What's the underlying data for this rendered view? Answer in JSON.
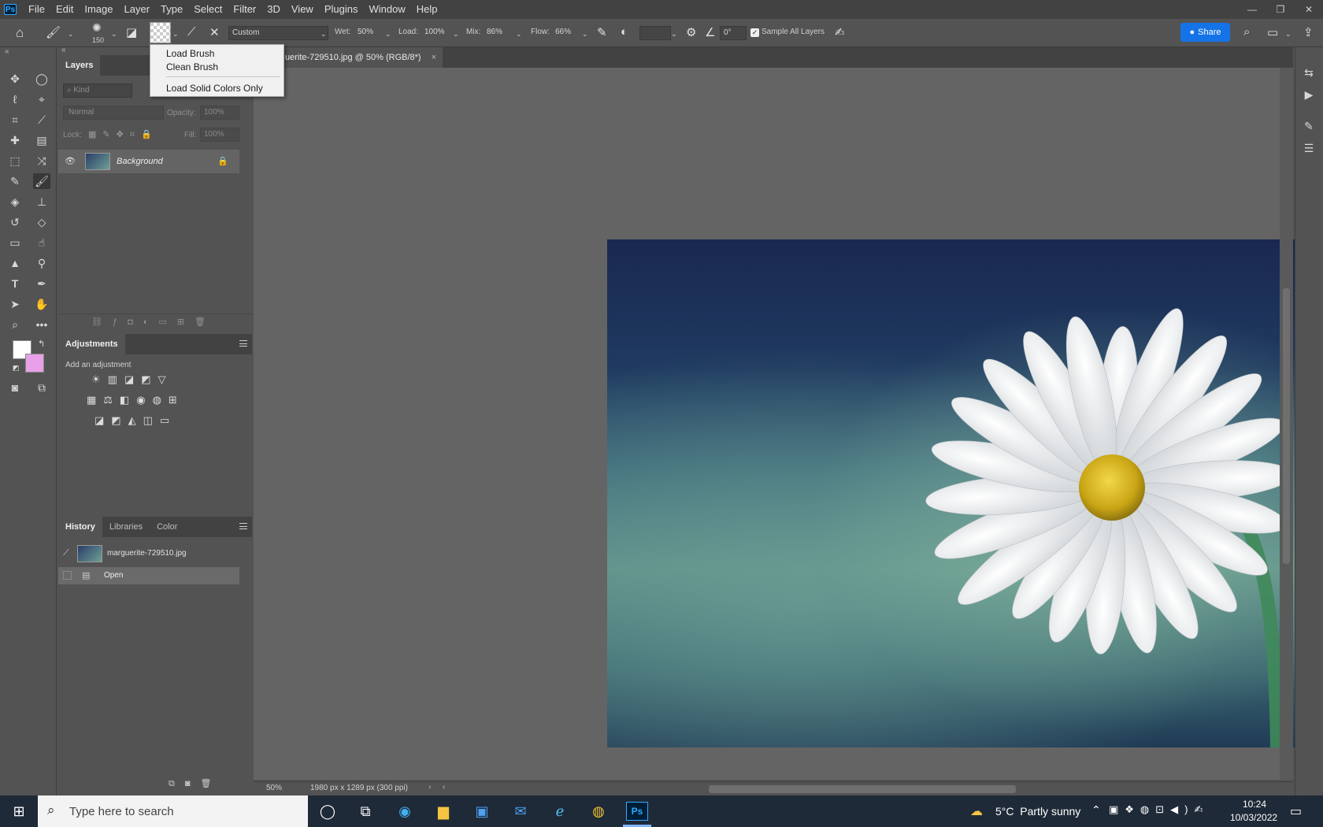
{
  "app": {
    "logo": "Ps"
  },
  "menu": [
    "File",
    "Edit",
    "Image",
    "Layer",
    "Type",
    "Select",
    "Filter",
    "3D",
    "View",
    "Plugins",
    "Window",
    "Help"
  ],
  "options": {
    "brush_size": "150",
    "preset": "Custom",
    "wet_label": "Wet:",
    "wet": "50%",
    "load_label": "Load:",
    "load": "100%",
    "mix_label": "Mix:",
    "mix": "86%",
    "flow_label": "Flow:",
    "flow": "66%",
    "angle": "0°",
    "sample_all_layers": "Sample All Layers",
    "share": "Share"
  },
  "dropdown": {
    "items": [
      "Load Brush",
      "Clean Brush",
      "Load Solid Colors Only"
    ]
  },
  "layers_panel": {
    "tab": "Layers",
    "kind_placeholder": "Kind",
    "blend_mode": "Normal",
    "opacity_label": "Opacity:",
    "opacity": "100%",
    "lock_label": "Lock:",
    "fill_label": "Fill:",
    "fill": "100%",
    "layer_name": "Background"
  },
  "adjustments_panel": {
    "tab": "Adjustments",
    "hint": "Add an adjustment"
  },
  "history_panel": {
    "tabs": [
      "History",
      "Libraries",
      "Color"
    ],
    "snapshot": "marguerite-729510.jpg",
    "step": "Open"
  },
  "document": {
    "tab_title": "uerite-729510.jpg @ 50% (RGB/8*)",
    "close": "×"
  },
  "status": {
    "zoom": "50%",
    "doc_info": "1980 px x 1289 px (300 ppi)"
  },
  "colors": {
    "foreground": "#ffffff",
    "background": "#e8a0e8",
    "accent": "#1473e6"
  },
  "taskbar": {
    "search_placeholder": "Type here to search",
    "weather": "5°C  Partly sunny",
    "time": "10:24",
    "date": "10/03/2022"
  }
}
